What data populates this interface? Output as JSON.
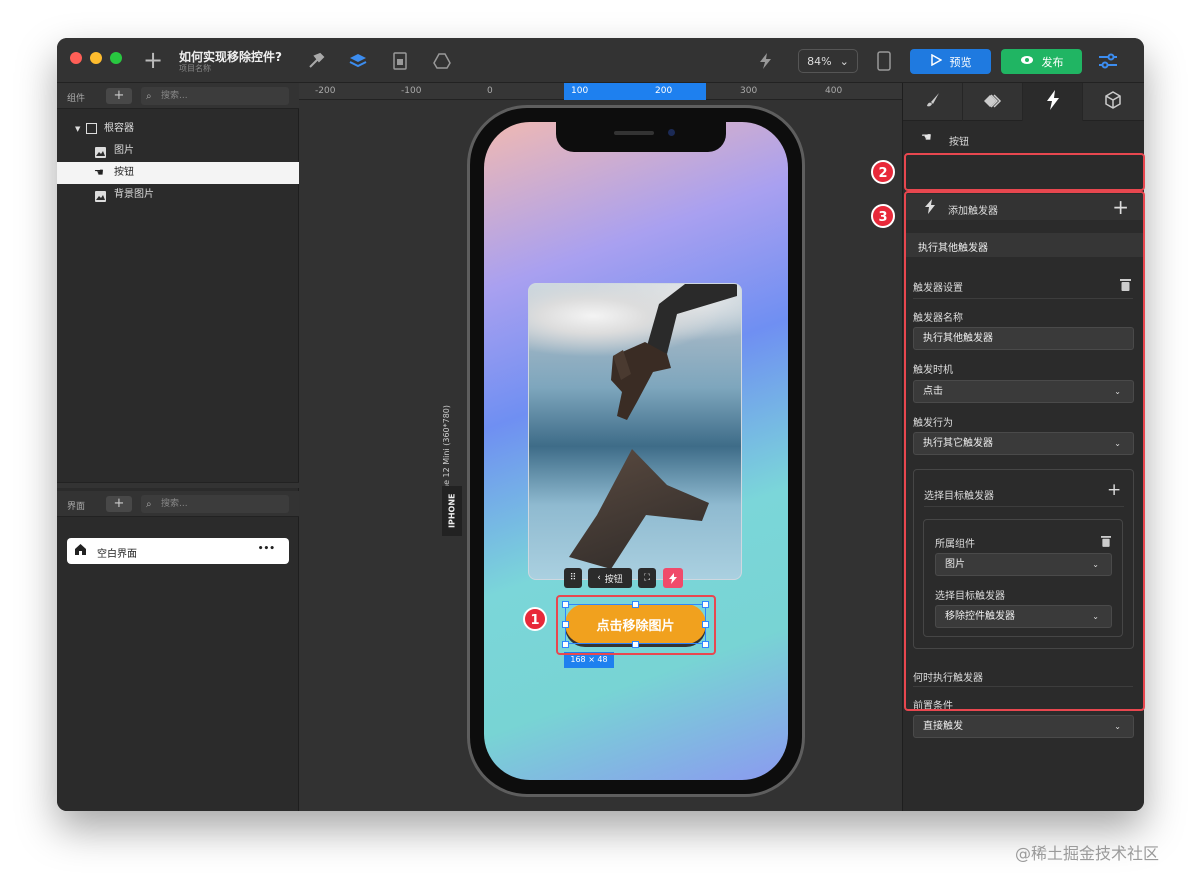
{
  "titlebar": {
    "project_title": "如何实现移除控件?",
    "project_subtitle": "项目名称",
    "zoom": "84%",
    "preview_label": "预览",
    "publish_label": "发布"
  },
  "left_panel": {
    "components_label": "组件",
    "search_placeholder": "搜索...",
    "tree": [
      {
        "label": "根容器",
        "icon": "square-icon"
      },
      {
        "label": "图片",
        "icon": "image-icon"
      },
      {
        "label": "按钮",
        "icon": "hand-pointer-icon"
      },
      {
        "label": "背景图片",
        "icon": "image-icon"
      }
    ],
    "pages_label": "界面",
    "pages_search_placeholder": "搜索...",
    "page_item": "空白界面",
    "page_more": "•••"
  },
  "ruler": {
    "ticks": [
      "-200",
      "-100",
      "0",
      "100",
      "200",
      "300",
      "400"
    ]
  },
  "canvas": {
    "device_label": "iPhone 12 Mini (360*780)",
    "device_tag": "IPHONE",
    "button_label": "点击移除图片",
    "float_label": "按钮",
    "dimension": "168 × 48"
  },
  "right_panel": {
    "selected_component": "按钮",
    "add_trigger_label": "添加触发器",
    "trigger_header": "执行其他触发器",
    "trigger_settings": "触发器设置",
    "name_label": "触发器名称",
    "name_value": "执行其他触发器",
    "timing_label": "触发时机",
    "timing_value": "点击",
    "action_label": "触发行为",
    "action_value": "执行其它触发器",
    "select_target_label": "选择目标触发器",
    "owner_label": "所属组件",
    "owner_value": "图片",
    "target_trigger_label": "选择目标触发器",
    "target_trigger_value": "移除控件触发器",
    "when_label": "何时执行触发器",
    "precondition_label": "前置条件",
    "precondition_value": "直接触发"
  },
  "annotations": [
    "1",
    "2",
    "3"
  ],
  "watermark": "@稀土掘金技术社区",
  "colors": {
    "accent_blue": "#1f7ae0",
    "publish_green": "#20b563",
    "button_orange": "#f1a11e",
    "annotation_red": "#e8474f"
  }
}
